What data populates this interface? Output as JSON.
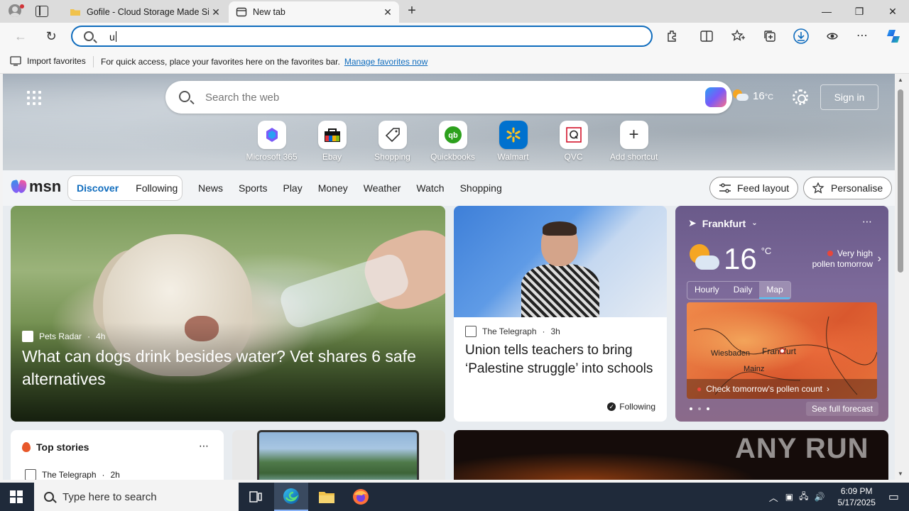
{
  "browser": {
    "tabs": [
      {
        "title": "Gofile - Cloud Storage Made Sim",
        "active": false
      },
      {
        "title": "New tab",
        "active": true
      }
    ],
    "address": {
      "value": "u"
    },
    "favorites_bar": {
      "import_label": "Import favorites",
      "message": "For quick access, place your favorites here on the favorites bar.",
      "manage_link": "Manage favorites now"
    }
  },
  "newtab": {
    "search_placeholder": "Search the web",
    "weather_temp": "16",
    "weather_unit": "°C",
    "sign_in": "Sign in",
    "shortcuts": [
      {
        "label": "Microsoft 365"
      },
      {
        "label": "Ebay"
      },
      {
        "label": "Shopping"
      },
      {
        "label": "Quickbooks"
      },
      {
        "label": "Walmart"
      },
      {
        "label": "QVC"
      },
      {
        "label": "Add shortcut"
      }
    ]
  },
  "msn": {
    "logo": "msn",
    "tabs": {
      "discover": "Discover",
      "following": "Following"
    },
    "nav": [
      "News",
      "Sports",
      "Play",
      "Money",
      "Weather",
      "Watch",
      "Shopping"
    ],
    "feed_layout": "Feed layout",
    "personalise": "Personalise"
  },
  "cards": {
    "main": {
      "source": "Pets Radar",
      "age": "4h",
      "headline": "What can dogs drink besides water? Vet shares 6 safe alternatives"
    },
    "telegraph": {
      "source": "The Telegraph",
      "age": "3h",
      "headline": "Union tells teachers to bring ‘Palestine struggle’ into schools",
      "following": "Following"
    },
    "weather": {
      "location": "Frankfurt",
      "temp": "16",
      "unit": "°C",
      "pollen_line1": "Very high",
      "pollen_line2": "pollen tomorrow",
      "tabs": [
        "Hourly",
        "Daily",
        "Map"
      ],
      "active_tab": "Map",
      "map_labels": {
        "wiesbaden": "Wiesbaden",
        "frankfurt": "Frankfurt",
        "mainz": "Mainz"
      },
      "pollen_cta": "Check tomorrow's pollen count",
      "forecast": "See full forecast"
    },
    "top_stories": {
      "title": "Top stories",
      "source": "The Telegraph",
      "age": "2h"
    }
  },
  "watermark": "ANY RUN",
  "taskbar": {
    "search_placeholder": "Type here to search",
    "time": "6:09 PM",
    "date": "5/17/2025"
  },
  "colors": {
    "accent": "#0f6cbd",
    "taskbar": "#1f2a3a"
  }
}
